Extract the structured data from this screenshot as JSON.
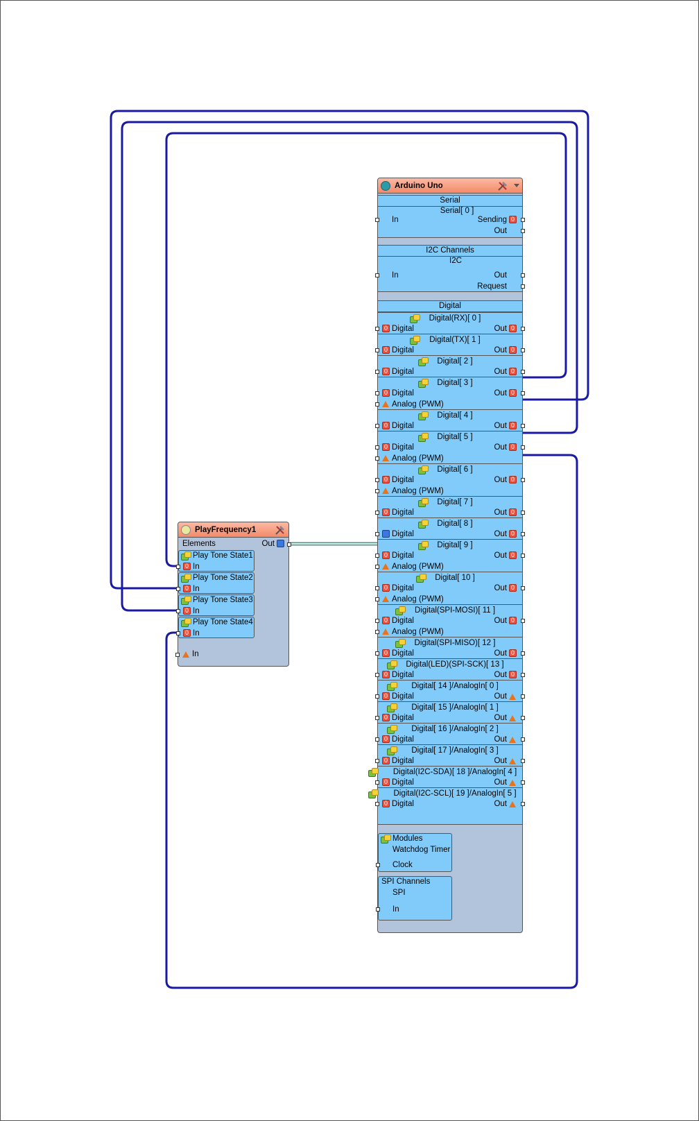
{
  "arduino": {
    "title": "Arduino Uno",
    "serial": {
      "header": "Serial",
      "channel": "Serial[ 0 ]",
      "in": "In",
      "sending": "Sending",
      "out": "Out"
    },
    "i2c": {
      "header": "I2C Channels",
      "channel": "I2C",
      "in": "In",
      "out": "Out",
      "request": "Request"
    },
    "digital_header": "Digital",
    "out_label": "Out",
    "digital_label": "Digital",
    "analog_label": "Analog (PWM)",
    "pins": [
      {
        "name": "Digital(RX)[ 0 ]"
      },
      {
        "name": "Digital(TX)[ 1 ]"
      },
      {
        "name": "Digital[ 2 ]"
      },
      {
        "name": "Digital[ 3 ]"
      },
      {
        "name": "Digital[ 4 ]"
      },
      {
        "name": "Digital[ 5 ]"
      },
      {
        "name": "Digital[ 6 ]"
      },
      {
        "name": "Digital[ 7 ]"
      },
      {
        "name": "Digital[ 8 ]"
      },
      {
        "name": "Digital[ 9 ]"
      },
      {
        "name": "Digital[ 10 ]"
      },
      {
        "name": "Digital(SPI-MOSI)[ 11 ]"
      },
      {
        "name": "Digital(SPI-MISO)[ 12 ]"
      },
      {
        "name": "Digital(LED)(SPI-SCK)[ 13 ]"
      },
      {
        "name": "Digital[ 14 ]/AnalogIn[ 0 ]"
      },
      {
        "name": "Digital[ 15 ]/AnalogIn[ 1 ]"
      },
      {
        "name": "Digital[ 16 ]/AnalogIn[ 2 ]"
      },
      {
        "name": "Digital[ 17 ]/AnalogIn[ 3 ]"
      },
      {
        "name": "Digital(I2C-SDA)[ 18 ]/AnalogIn[ 4 ]"
      },
      {
        "name": "Digital(I2C-SCL)[ 19 ]/AnalogIn[ 5 ]"
      }
    ],
    "modules": {
      "header": "Modules",
      "watchdog": "Watchdog Timer",
      "clock": "Clock"
    },
    "spi": {
      "header": "SPI Channels",
      "channel": "SPI",
      "in": "In"
    }
  },
  "playfreq": {
    "title": "PlayFrequency1",
    "elements": "Elements",
    "out": "Out",
    "states": [
      {
        "name": "Play Tone State1",
        "in": "In"
      },
      {
        "name": "Play Tone State2",
        "in": "In"
      },
      {
        "name": "Play Tone State3",
        "in": "In"
      },
      {
        "name": "Play Tone State4",
        "in": "In"
      }
    ],
    "in": "In"
  },
  "colors": {
    "wire": "#1a1aa0",
    "link": "#8fc9c0",
    "block": "#80cbfa",
    "body": "#b2c4dc",
    "title": "#f58a6a"
  }
}
